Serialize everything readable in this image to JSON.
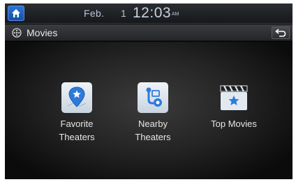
{
  "status": {
    "date": "Feb.",
    "day": "1",
    "time": "12:03",
    "ampm": "AM"
  },
  "header": {
    "title": "Movies",
    "icon": "movies-reel-icon",
    "back_icon": "back-arrow-icon"
  },
  "menu": {
    "items": [
      {
        "line1": "Favorite",
        "line2": "Theaters",
        "icon": "map-pin-star-icon"
      },
      {
        "line1": "Nearby",
        "line2": "Theaters",
        "icon": "route-map-icon"
      },
      {
        "line1": "Top Movies",
        "line2": "",
        "icon": "clapperboard-star-icon"
      }
    ]
  },
  "colors": {
    "accent_blue": "#2d73d8",
    "icon_tile": "#dfe6ee",
    "text": "#e6e6e6"
  }
}
